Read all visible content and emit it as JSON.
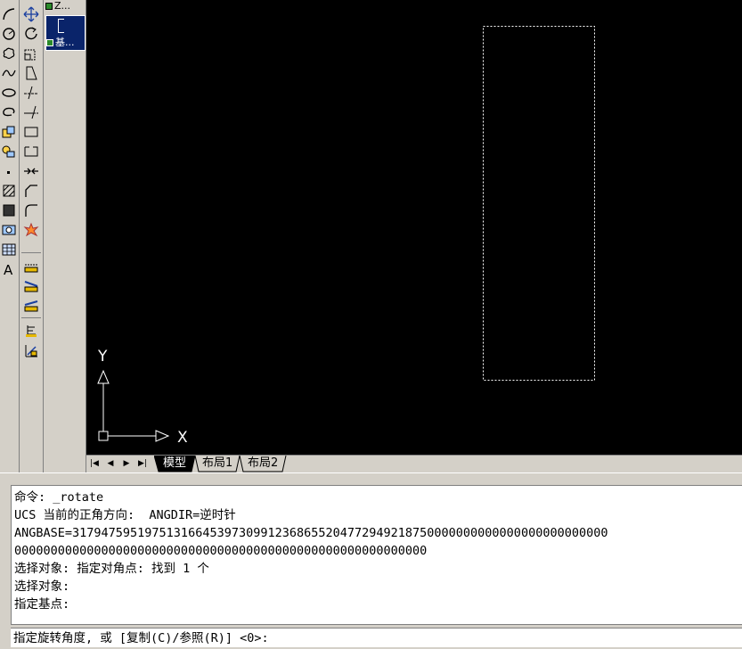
{
  "palette": {
    "item1": "Z...",
    "item2": "基..."
  },
  "layout_tabs": {
    "model": "模型",
    "layout1": "布局1",
    "layout2": "布局2"
  },
  "ucs": {
    "x_label": "X",
    "y_label": "Y"
  },
  "command": {
    "history": [
      "命令: _rotate",
      "UCS 当前的正角方向:  ANGDIR=逆时针",
      "ANGBASE=31794759519751316645397309912368655204772949218750000000000000000000000000",
      "000000000000000000000000000000000000000000000000000000000",
      "选择对象: 指定对角点: 找到 1 个",
      "选择对象:",
      "指定基点:"
    ],
    "prompt": "指定旋转角度, 或 [复制(C)/参照(R)] <0>:"
  },
  "colors": {
    "canvas": "#000000",
    "selection": "#ffffff",
    "chrome": "#d4d0c8",
    "highlight": "#0a246a"
  }
}
